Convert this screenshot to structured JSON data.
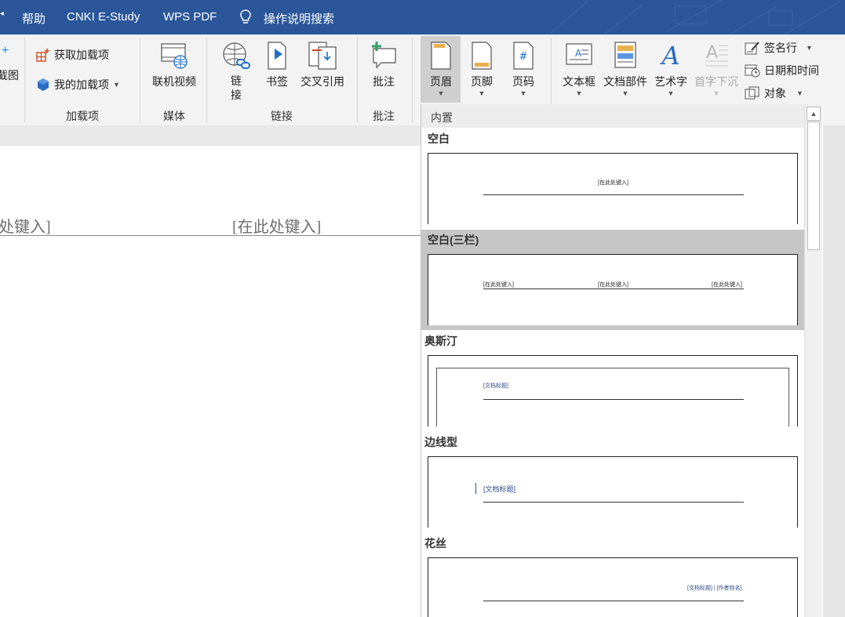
{
  "titlebar": {
    "tabs": [
      "帮助",
      "CNKI E-Study",
      "WPS PDF"
    ],
    "search_label": "操作说明搜索"
  },
  "ribbon": {
    "partial_left_label": "截图",
    "addins": {
      "get_label": "获取加载项",
      "my_label": "我的加载项",
      "group_label": "加载项"
    },
    "media": {
      "online_video_label": "联机视频",
      "group_label": "媒体"
    },
    "links": {
      "link_label": "链接",
      "bookmark_label": "书签",
      "cross_ref_label": "交叉引用",
      "group_label": "链接"
    },
    "comments": {
      "comment_label": "批注",
      "group_label": "批注"
    },
    "header_footer": {
      "header_label": "页眉",
      "footer_label": "页脚",
      "page_number_label": "页码"
    },
    "text": {
      "textbox_label": "文本框",
      "quick_parts_label": "文档部件",
      "wordart_label": "艺术字",
      "dropcap_label": "首字下沉",
      "signature_label": "签名行",
      "datetime_label": "日期和时间",
      "object_label": "对象"
    }
  },
  "document": {
    "placeholder_left": "处键入]",
    "placeholder_mid": "[在此处键入]"
  },
  "gallery": {
    "section_label": "内置",
    "items": [
      {
        "title": "空白",
        "texts": [
          "[在此处键入]"
        ]
      },
      {
        "title": "空白(三栏)",
        "texts": [
          "[在此处键入]",
          "[在此处键入]",
          "[在此处键入]"
        ]
      },
      {
        "title": "奥斯汀",
        "texts": [
          "[文档标题]"
        ]
      },
      {
        "title": "边线型",
        "texts": [
          "[文档标题]"
        ]
      },
      {
        "title": "花丝",
        "texts": [
          "[文档标题] | [作者姓名]"
        ]
      }
    ]
  },
  "colors": {
    "title_bar": "#2b579a",
    "ribbon_bg": "#f3f3f3",
    "selected_bg": "#c6c6c6",
    "accent_blue": "#2f4a8a"
  }
}
